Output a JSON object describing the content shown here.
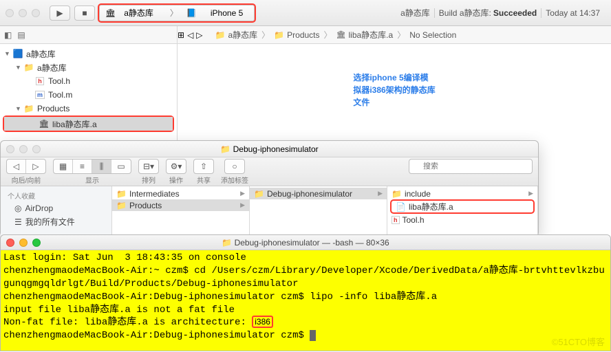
{
  "xcode": {
    "scheme_project": "a静态库",
    "scheme_device": "iPhone 5",
    "status_project": "a静态库",
    "status_build_prefix": "Build a静态库:",
    "status_result": "Succeeded",
    "status_time": "Today at 14:37",
    "crumbs": [
      "a静态库",
      "Products",
      "liba静态库.a",
      "No Selection"
    ],
    "tree": [
      {
        "label": "a静态库",
        "indent": 0,
        "disclosure": "▼",
        "type": "project"
      },
      {
        "label": "a静态库",
        "indent": 1,
        "disclosure": "▼",
        "type": "folder"
      },
      {
        "label": "Tool.h",
        "indent": 2,
        "disclosure": "",
        "type": "h"
      },
      {
        "label": "Tool.m",
        "indent": 2,
        "disclosure": "",
        "type": "m"
      },
      {
        "label": "Products",
        "indent": 1,
        "disclosure": "▼",
        "type": "folder"
      },
      {
        "label": "liba静态库.a",
        "indent": 2,
        "disclosure": "",
        "type": "lib",
        "selected": true,
        "highlight": true
      }
    ],
    "annotation_lines": [
      "选择iphone 5编译模",
      "拟器i386架构的静态库",
      "文件"
    ]
  },
  "finder": {
    "title": "Debug-iphonesimulator",
    "toolbar_labels": {
      "nav": "向后/向前",
      "view": "显示",
      "arrange": "排列",
      "action": "操作",
      "share": "共享",
      "tags": "添加标签"
    },
    "search_placeholder": "搜索",
    "sidebar": {
      "header": "个人收藏",
      "items": [
        "AirDrop",
        "我的所有文件"
      ]
    },
    "col1": [
      {
        "label": "Intermediates",
        "type": "folder",
        "chev": true
      },
      {
        "label": "Products",
        "type": "folder",
        "chev": true,
        "sel": true
      }
    ],
    "col2": [
      {
        "label": "Debug-iphonesimulator",
        "type": "folder",
        "chev": true,
        "sel": true
      }
    ],
    "col3": [
      {
        "label": "include",
        "type": "folder",
        "chev": true
      },
      {
        "label": "liba静态库.a",
        "type": "file",
        "highlight": true
      },
      {
        "label": "Tool.h",
        "type": "h"
      }
    ]
  },
  "terminal": {
    "title": "Debug-iphonesimulator — -bash — 80×36",
    "lines": [
      "Last login: Sat Jun  3 18:43:35 on console",
      "chenzhengmaodeMacBook-Air:~ czm$ cd /Users/czm/Library/Developer/Xcode/DerivedData/a静态库-brtvhttevlkzbugunqgmgqldrlgt/Build/Products/Debug-iphonesimulator",
      "chenzhengmaodeMacBook-Air:Debug-iphonesimulator czm$ lipo -info liba静态库.a",
      "input file liba静态库.a is not a fat file",
      "Non-fat file: liba静态库.a is architecture: "
    ],
    "arch_highlight": "i386",
    "prompt": "chenzhengmaodeMacBook-Air:Debug-iphonesimulator czm$ ",
    "watermark": "©51CTO博客"
  }
}
